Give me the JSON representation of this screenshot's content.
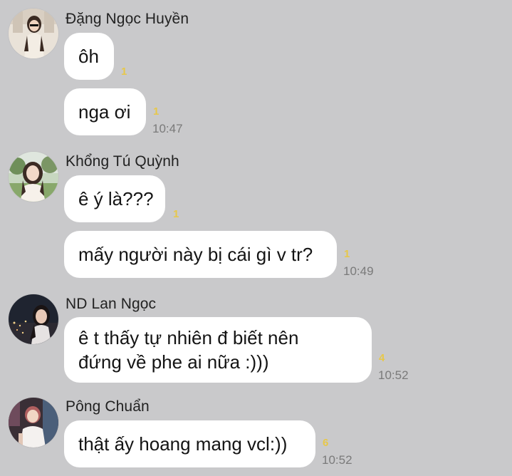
{
  "messages": [
    {
      "sender": "Đặng Ngọc Huyền",
      "avatar_icon": "user-avatar-icon",
      "bubbles": [
        {
          "text": "ôh",
          "read_count": "1",
          "time": ""
        },
        {
          "text": "nga ơi",
          "read_count": "1",
          "time": "10:47"
        }
      ]
    },
    {
      "sender": "Khổng Tú Quỳnh",
      "avatar_icon": "user-avatar-icon",
      "bubbles": [
        {
          "text": "ê ý là???",
          "read_count": "1",
          "time": ""
        },
        {
          "text": "mấy người này bị cái gì v tr?",
          "read_count": "1",
          "time": "10:49"
        }
      ]
    },
    {
      "sender": "ND Lan Ngọc",
      "avatar_icon": "user-avatar-icon",
      "bubbles": [
        {
          "lines": [
            "ê t thấy tự nhiên đ biết nên",
            "đứng về phe ai nữa :)))"
          ],
          "read_count": "4",
          "time": "10:52"
        }
      ]
    },
    {
      "sender": "Pông Chuẩn",
      "avatar_icon": "user-avatar-icon",
      "bubbles": [
        {
          "text": "thật ấy hoang mang vcl:))",
          "read_count": "6",
          "time": "10:52"
        }
      ]
    }
  ],
  "colors": {
    "background": "#c9c9cb",
    "bubble": "#ffffff",
    "read_count": "#e7c84a",
    "timestamp": "#7a7a7a"
  }
}
